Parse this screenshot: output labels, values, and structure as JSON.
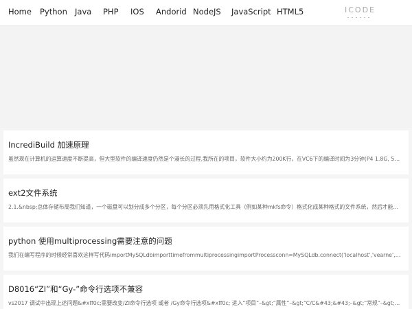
{
  "nav": {
    "items": [
      "Home",
      "Python",
      "Java",
      "PHP",
      "IOS",
      "Andorid",
      "NodeJS",
      "JavaScript",
      "HTML5"
    ],
    "logo_text": "ICODE"
  },
  "articles": [
    {
      "title": "IncrediBuild 加速原理",
      "summary": "虽然现在计算机的运算速度不断提高，但大型软件的编译速度仍然是个漫长的过程,我所在的项目，软件大小约为200K行，在VC6下的编译时间为3分钟(P4 1.8G, 512M)，在…"
    },
    {
      "title": "ext2文件系统",
      "summary": "2.1.&nbsp;总体存储布局我们知道，一个磁盘可以划分成多个分区，每个分区必须先用格式化工具（例如某种mkfs命令）格式化成某种格式的文件系统，然后才能存储文…"
    },
    {
      "title": "python 使用multiprocessing需要注意的问题",
      "summary": "我们在编写程序的时候经常喜欢这样写代码importMySQLdbimporttimefrommultiprocessingimportProcessconn=MySQLdb.connect('localhost','vearne','xx','test')deff(name…"
    },
    {
      "title": "D8016“ZI”和“Gy-”命令行选项不兼容",
      "summary": "vs2017 调试中出现上述问题&#xff0c;需要改变/ZI命令行选项 或者 /Gy命令行选项&#xff0c; 进入“项目”–&gt;“属性”–&gt;“C/C&#43;&#43;–&gt;“常规”–&gt;“调试信息格式”–&gt;…"
    }
  ]
}
